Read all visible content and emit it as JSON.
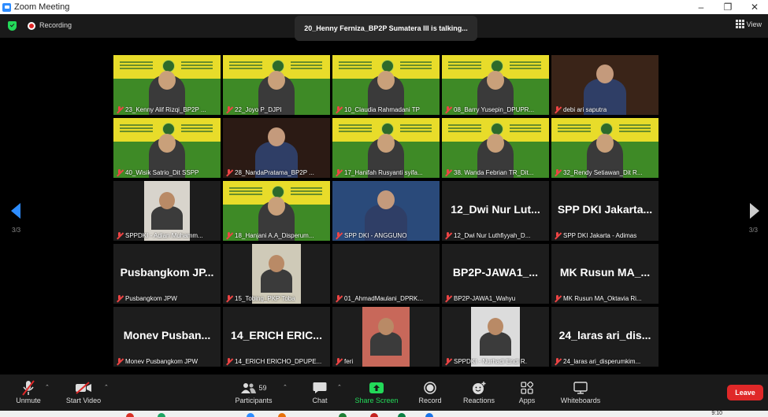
{
  "window": {
    "title": "Zoom Meeting"
  },
  "topbar": {
    "recording": "Recording",
    "talking": "20_Henny Ferniza_BP2P Sumatera III is talking...",
    "view": "View"
  },
  "pager": {
    "left": "3/3",
    "right": "3/3"
  },
  "tiles": [
    {
      "name": "23_Kenny Alif Rizqi_BP2P ...",
      "kind": "banner"
    },
    {
      "name": "22_Joyo P_DJPI",
      "kind": "banner"
    },
    {
      "name": "10_Claudia Rahmadani TP",
      "kind": "banner"
    },
    {
      "name": "08_Barry Yusepin_DPUPR...",
      "kind": "banner"
    },
    {
      "name": "debi ari saputra",
      "kind": "video"
    },
    {
      "name": "40_Wisik Satrio_Dit SSPP",
      "kind": "banner"
    },
    {
      "name": "28_NandaPratama_BP2P ...",
      "kind": "video"
    },
    {
      "name": "17_Hanifah Rusyanti syifa...",
      "kind": "banner"
    },
    {
      "name": "38. Wanda Febrian TR_Dit...",
      "kind": "banner"
    },
    {
      "name": "32_Rendy Setiawan_Dit R...",
      "kind": "banner"
    },
    {
      "name": "SPPDKI - Adian Muhamm...",
      "kind": "thumb"
    },
    {
      "name": "18_Hanjani A.A_Disperum...",
      "kind": "banner"
    },
    {
      "name": "SPP DKI - ANGGUNO",
      "kind": "video"
    },
    {
      "name": "12_Dwi Nur Luthfiyyah_D...",
      "kind": "text",
      "big": "12_Dwi Nur Lut..."
    },
    {
      "name": "SPP DKI Jakarta - Adimas",
      "kind": "text",
      "big": "SPP DKI Jakarta..."
    },
    {
      "name": "Pusbangkom JPW",
      "kind": "text",
      "big": "Pusbangkom JP..."
    },
    {
      "name": "15_Tobing_PKP Toba",
      "kind": "thumb"
    },
    {
      "name": "01_AhmadMaulani_DPRK...",
      "kind": "blank"
    },
    {
      "name": "BP2P-JAWA1_Wahyu",
      "kind": "text",
      "big": "BP2P-JAWA1_..."
    },
    {
      "name": "MK Rusun MA_Oktavia Ri...",
      "kind": "text",
      "big": "MK Rusun MA_..."
    },
    {
      "name": "Monev Pusbangkom JPW",
      "kind": "text",
      "big": "Monev Pusban..."
    },
    {
      "name": "14_ERICH ERICHO_DPUPE...",
      "kind": "text",
      "big": "14_ERICH ERIC..."
    },
    {
      "name": "feri",
      "kind": "thumb"
    },
    {
      "name": "SPPDKI - Nurhadi Endi R.",
      "kind": "thumb"
    },
    {
      "name": "24_laras ari_disperumkim...",
      "kind": "text",
      "big": "24_laras ari_dis..."
    }
  ],
  "toolbar": {
    "unmute": "Unmute",
    "start_video": "Start Video",
    "participants": "Participants",
    "participants_count": "59",
    "chat": "Chat",
    "share": "Share Screen",
    "record": "Record",
    "reactions": "Reactions",
    "apps": "Apps",
    "whiteboards": "Whiteboards",
    "leave": "Leave"
  },
  "taskbar": {
    "clock": "9:10"
  },
  "colors": {
    "accent": "#2d8cff",
    "leave": "#e02828",
    "share": "#23d959",
    "banner_green": "#3e8a26",
    "banner_yellow": "#e8dc2a"
  }
}
